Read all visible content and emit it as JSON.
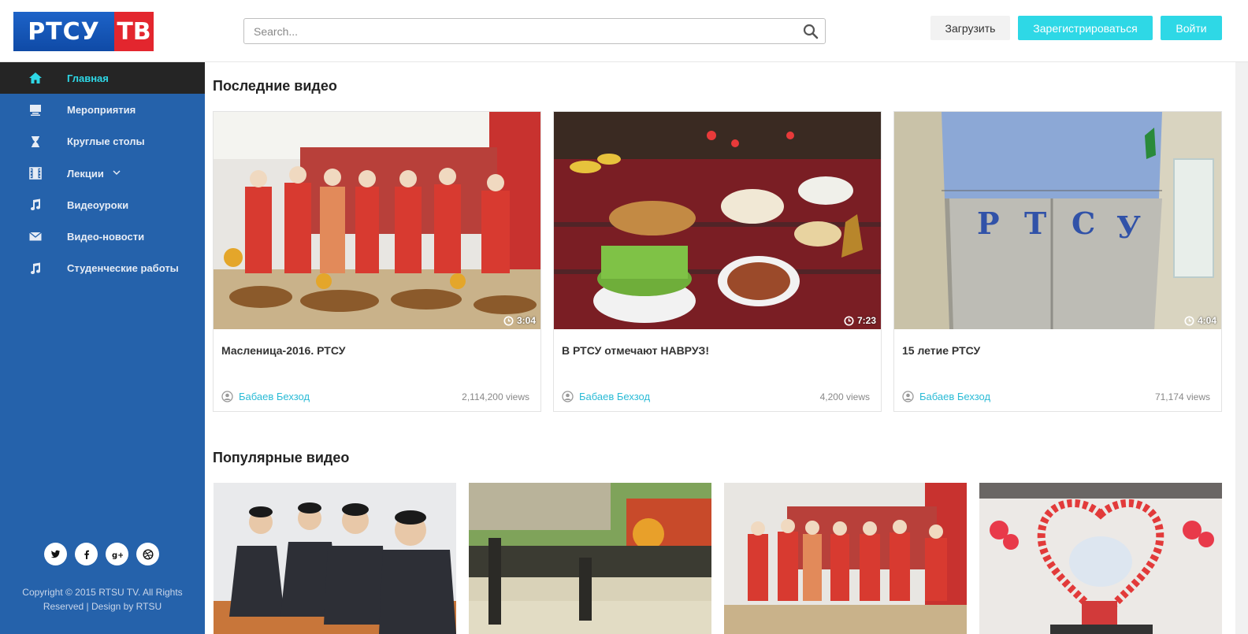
{
  "logo": {
    "part1": "РТСУ",
    "part2": "ТВ"
  },
  "search": {
    "placeholder": "Search..."
  },
  "header": {
    "upload": "Загрузить",
    "register": "Зарегистрироваться",
    "login": "Войти"
  },
  "colors": {
    "sidebar": "#2562ab",
    "accent": "#2ed8e6",
    "active_bg": "#252525"
  },
  "sidebar": {
    "items": [
      {
        "label": "Главная",
        "icon": "home-icon"
      },
      {
        "label": "Мероприятия",
        "icon": "presentation-icon"
      },
      {
        "label": "Круглые столы",
        "icon": "hourglass-icon"
      },
      {
        "label": "Лекции",
        "icon": "film-icon"
      },
      {
        "label": "Видеоуроки",
        "icon": "music-icon"
      },
      {
        "label": "Видео-новости",
        "icon": "envelope-icon"
      },
      {
        "label": "Студенческие работы",
        "icon": "music-icon"
      }
    ],
    "social": [
      "twitter-icon",
      "facebook-icon",
      "google-plus-icon",
      "dribbble-icon"
    ],
    "copyright_line1": "Copyright © 2015 RTSU TV. All Rights",
    "copyright_line2": "Reserved | Design by RTSU"
  },
  "latest": {
    "title": "Последние видео",
    "videos": [
      {
        "title": "Масленица-2016. РТСУ",
        "duration": "3:04",
        "author": "Бабаев Бехзод",
        "views": "2,114,200 views"
      },
      {
        "title": "В РТСУ отмечают НАВРУЗ!",
        "duration": "7:23",
        "author": "Бабаев Бехзод",
        "views": "4,200 views"
      },
      {
        "title": "15 летие РТСУ",
        "duration": "4:04",
        "author": "Бабаев Бехзод",
        "views": "71,174 views"
      }
    ]
  },
  "popular": {
    "title": "Популярные видео"
  }
}
